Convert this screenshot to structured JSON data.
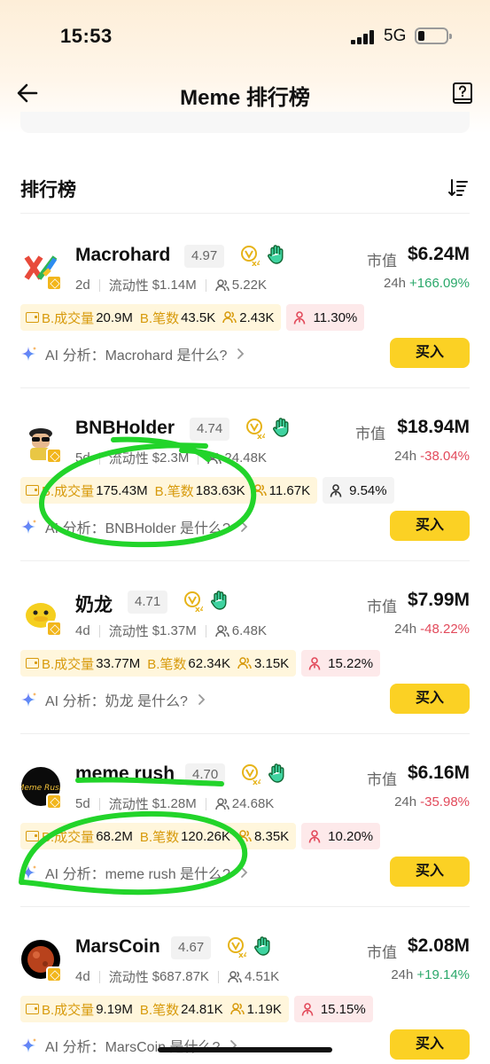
{
  "status_bar": {
    "time": "15:53",
    "network": "5G"
  },
  "header": {
    "title": "Meme 排行榜"
  },
  "section": {
    "title": "排行榜"
  },
  "labels": {
    "market_cap": "市值",
    "period": "24h",
    "liquidity_prefix": "流动性",
    "volume": "B.成交量",
    "tx_count": "B.笔数",
    "buy": "买入"
  },
  "colors": {
    "accent_yellow": "#fbd124",
    "up_green": "#2aa86a",
    "down_red": "#e24a5b",
    "tag_yellow": "#fff6dc",
    "tag_pink": "#fde9ea",
    "annotation_green": "#22d42a"
  },
  "items": [
    {
      "name": "Macrohard",
      "score": "4.97",
      "age": "2d",
      "liquidity": "$1.14M",
      "holders": "5.22K",
      "market_cap": "$6.24M",
      "change": "+166.09%",
      "direction": "up",
      "volume": "20.9M",
      "tx": "43.5K",
      "traders": "2.43K",
      "pct": "11.30%",
      "pct_style": "pink",
      "ai": "AI 分析：Macrohard 是什么?"
    },
    {
      "name": "BNBHolder",
      "score": "4.74",
      "age": "5d",
      "liquidity": "$2.3M",
      "holders": "24.48K",
      "market_cap": "$18.94M",
      "change": "-38.04%",
      "direction": "down",
      "volume": "175.43M",
      "tx": "183.63K",
      "traders": "11.67K",
      "pct": "9.54%",
      "pct_style": "grey",
      "ai": "AI 分析：BNBHolder 是什么?"
    },
    {
      "name": "奶龙",
      "score": "4.71",
      "age": "4d",
      "liquidity": "$1.37M",
      "holders": "6.48K",
      "market_cap": "$7.99M",
      "change": "-48.22%",
      "direction": "down",
      "volume": "33.77M",
      "tx": "62.34K",
      "traders": "3.15K",
      "pct": "15.22%",
      "pct_style": "pink",
      "ai": "AI 分析：奶龙 是什么?"
    },
    {
      "name": "meme rush",
      "score": "4.70",
      "age": "5d",
      "liquidity": "$1.28M",
      "holders": "24.68K",
      "market_cap": "$6.16M",
      "change": "-35.98%",
      "direction": "down",
      "volume": "68.2M",
      "tx": "120.26K",
      "traders": "8.35K",
      "pct": "10.20%",
      "pct_style": "pink",
      "ai": "AI 分析：meme rush 是什么?"
    },
    {
      "name": "MarsCoin",
      "score": "4.67",
      "age": "4d",
      "liquidity": "$687.87K",
      "holders": "4.51K",
      "market_cap": "$2.08M",
      "change": "+19.14%",
      "direction": "up",
      "volume": "9.19M",
      "tx": "24.81K",
      "traders": "1.19K",
      "pct": "15.15%",
      "pct_style": "pink",
      "ai": "AI 分析：MarsCoin 是什么?"
    }
  ]
}
